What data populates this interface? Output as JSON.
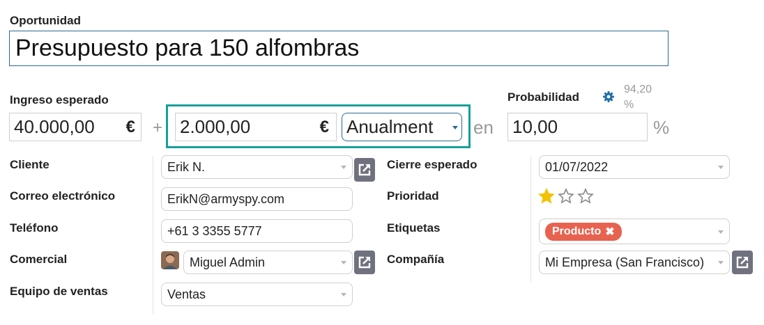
{
  "opportunity": {
    "label": "Oportunidad",
    "value": "Presupuesto para 150 alfombras"
  },
  "revenue": {
    "label": "Ingreso esperado",
    "amount": "40.000,00",
    "currency_symbol": "€",
    "plus": "+",
    "recurring_amount": "2.000,00",
    "recurring_currency_symbol": "€",
    "recurring_plan": "Anualment",
    "en": "en"
  },
  "probability": {
    "label": "Probabilidad",
    "auto_value": "94,20",
    "auto_unit": "%",
    "value": "10,00",
    "unit": "%"
  },
  "left_fields": {
    "client_label": "Cliente",
    "client_value": "Erik N.",
    "email_label": "Correo electrónico",
    "email_value": "ErikN@armyspy.com",
    "phone_label": "Teléfono",
    "phone_value": "+61 3 3355 5777",
    "salesperson_label": "Comercial",
    "salesperson_value": "Miguel Admin",
    "team_label": "Equipo de ventas",
    "team_value": "Ventas"
  },
  "right_fields": {
    "close_label": "Cierre esperado",
    "close_value": "01/07/2022",
    "priority_label": "Prioridad",
    "priority_stars": 1,
    "priority_max": 3,
    "tags_label": "Etiquetas",
    "tag_value": "Producto",
    "company_label": "Compañía",
    "company_value": "Mi Empresa (San Francisco)"
  },
  "colors": {
    "highlight_border": "#16a09a",
    "tag_bg": "#e86250",
    "star_filled": "#f2c200",
    "gear": "#1f6fa5",
    "ext_button": "#6f717f"
  }
}
